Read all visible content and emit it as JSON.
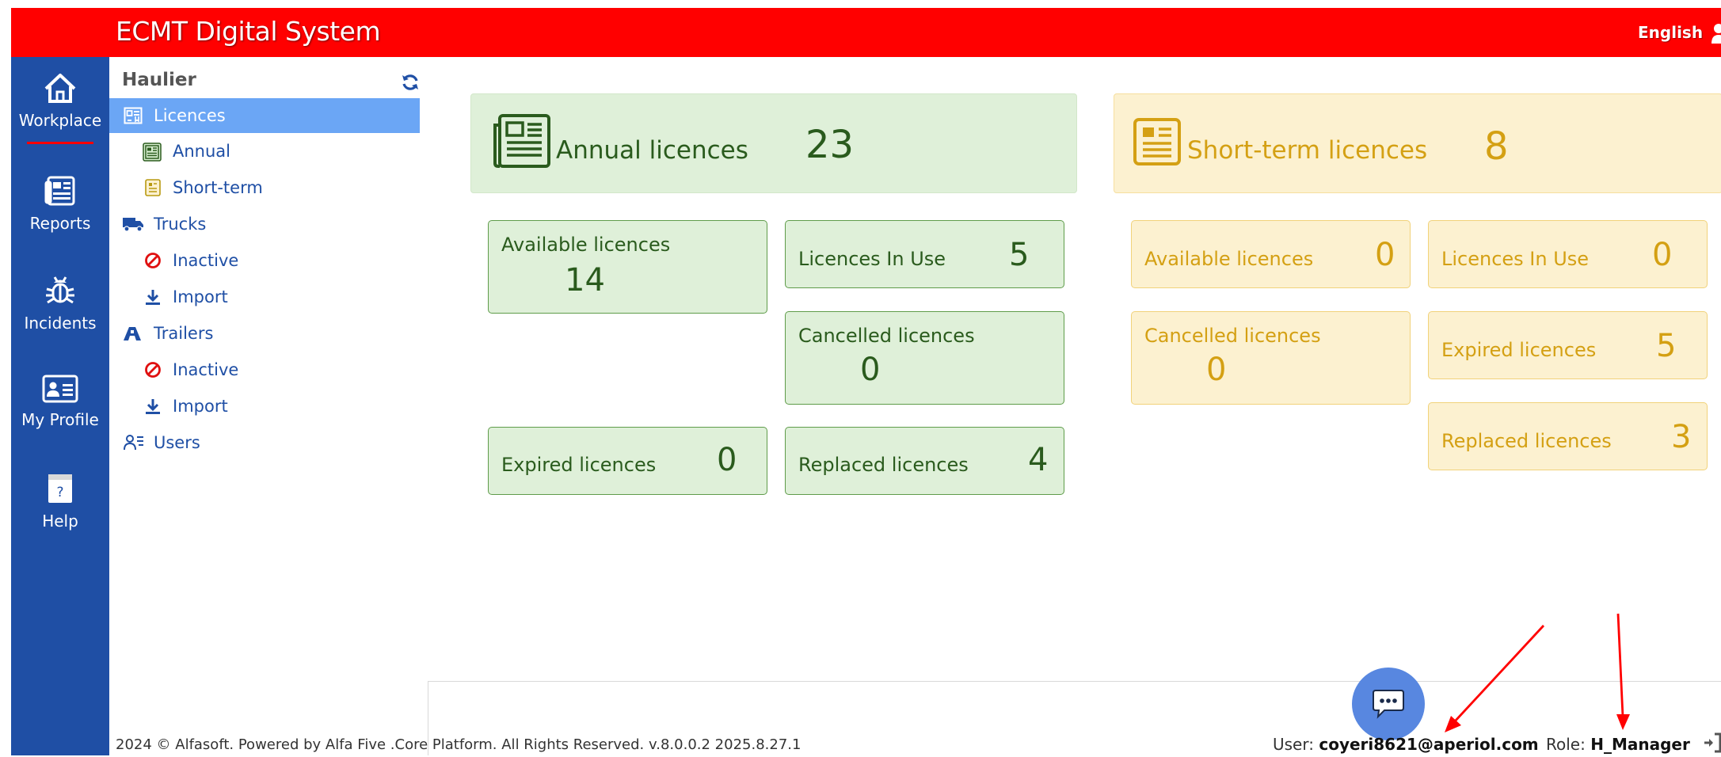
{
  "app": {
    "title": "ECMT Digital System",
    "language": "English"
  },
  "nav": {
    "items": [
      {
        "label": "Workplace",
        "icon": "home-icon"
      },
      {
        "label": "Reports",
        "icon": "reports-icon"
      },
      {
        "label": "Incidents",
        "icon": "bug-icon"
      },
      {
        "label": "My Profile",
        "icon": "id-card-icon"
      },
      {
        "label": "Help",
        "icon": "help-icon"
      }
    ],
    "active": "Workplace"
  },
  "subpanel": {
    "title": "Haulier",
    "items": [
      {
        "label": "Licences",
        "icon": "licence-icon"
      },
      {
        "label": "Annual",
        "icon": "annual-icon"
      },
      {
        "label": "Short-term",
        "icon": "short-term-icon"
      },
      {
        "label": "Trucks",
        "icon": "truck-icon"
      },
      {
        "label": "Inactive",
        "icon": "ban-icon"
      },
      {
        "label": "Import",
        "icon": "download-icon"
      },
      {
        "label": "Trailers",
        "icon": "trailer-icon"
      },
      {
        "label": "Inactive",
        "icon": "ban-icon"
      },
      {
        "label": "Import",
        "icon": "download-icon"
      },
      {
        "label": "Users",
        "icon": "users-icon"
      }
    ],
    "active": "Licences"
  },
  "annual": {
    "label": "Annual licences",
    "count": "23",
    "color": "#2a5b1d",
    "available": {
      "label": "Available licences",
      "value": "14"
    },
    "in_use": {
      "label": "Licences In Use",
      "value": "5"
    },
    "cancelled": {
      "label": "Cancelled licences",
      "value": "0"
    },
    "expired": {
      "label": "Expired licences",
      "value": "0"
    },
    "replaced": {
      "label": "Replaced licences",
      "value": "4"
    }
  },
  "short_term": {
    "label": "Short-term licences",
    "count": "8",
    "color": "#d4a013",
    "available": {
      "label": "Available licences",
      "value": "0"
    },
    "in_use": {
      "label": "Licences In Use",
      "value": "0"
    },
    "cancelled": {
      "label": "Cancelled licences",
      "value": "0"
    },
    "expired": {
      "label": "Expired licences",
      "value": "5"
    },
    "replaced": {
      "label": "Replaced licences",
      "value": "3"
    }
  },
  "footer": {
    "copyright": "2024 © Alfasoft. Powered by Alfa Five .Core Platform. All Rights Reserved. v.8.0.0.2 2025.8.27.1",
    "user_label": "User:",
    "user_value": "coyeri8621@aperiol.com",
    "role_label": "Role:",
    "role_value": "H_Manager"
  },
  "colors": {
    "topbar": "#ff0000",
    "nav": "#1f4fa5",
    "active_item": "#6ba6f5",
    "annotation_arrow": "#ff0000"
  }
}
